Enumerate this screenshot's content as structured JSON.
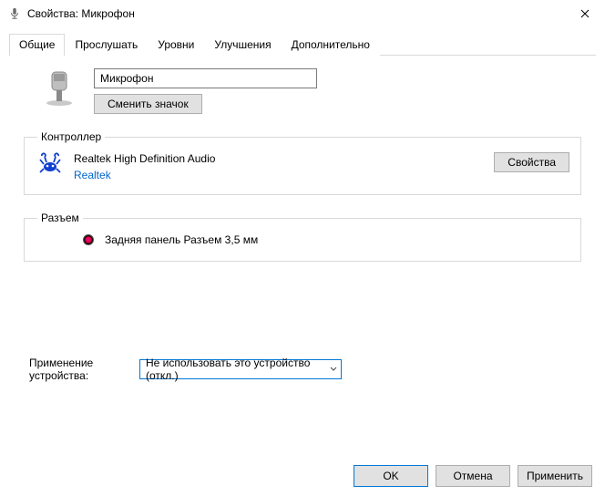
{
  "window": {
    "title": "Свойства: Микрофон"
  },
  "tabs": {
    "general": "Общие",
    "listen": "Прослушать",
    "levels": "Уровни",
    "enhancements": "Улучшения",
    "advanced": "Дополнительно"
  },
  "general": {
    "device_name": "Микрофон",
    "change_icon": "Сменить значок"
  },
  "controller": {
    "legend": "Контроллер",
    "name": "Realtek High Definition Audio",
    "vendor": "Realtek",
    "properties_btn": "Свойства"
  },
  "jack": {
    "legend": "Разъем",
    "description": "Задняя панель Разъем 3,5 мм"
  },
  "usage": {
    "label": "Применение устройства:",
    "value": "Не использовать это устройство (откл.)"
  },
  "footer": {
    "ok": "OK",
    "cancel": "Отмена",
    "apply": "Применить"
  }
}
